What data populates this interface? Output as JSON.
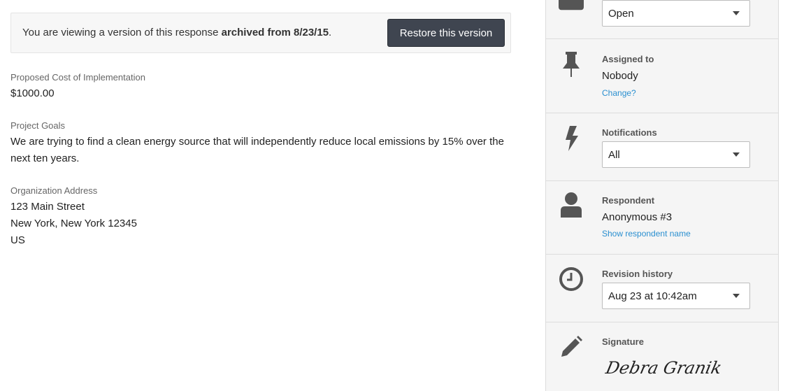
{
  "banner": {
    "text_prefix": "You are viewing a version of this response ",
    "text_bold": "archived from 8/23/15",
    "text_suffix": ".",
    "restore_label": "Restore this version"
  },
  "fields": [
    {
      "label": "Proposed Cost of Implementation",
      "value_lines": [
        "$1000.00"
      ]
    },
    {
      "label": "Project Goals",
      "value_lines": [
        "We are trying to find a clean energy source that will independently reduce local emissions by 15% over the",
        "next ten years."
      ]
    },
    {
      "label": "Organization Address",
      "value_lines": [
        "123 Main Street",
        "New York, New York 12345",
        "US"
      ]
    }
  ],
  "sidebar": {
    "status": {
      "icon": "tag-icon",
      "selected": "Open"
    },
    "assigned": {
      "icon": "pin-icon",
      "title": "Assigned to",
      "value": "Nobody",
      "link": "Change?"
    },
    "notifications": {
      "icon": "lightning-icon",
      "title": "Notifications",
      "selected": "All"
    },
    "respondent": {
      "icon": "person-icon",
      "title": "Respondent",
      "value": "Anonymous #3",
      "link": "Show respondent name"
    },
    "revision": {
      "icon": "clock-icon",
      "title": "Revision history",
      "selected": "Aug 23 at 10:42am"
    },
    "signature": {
      "icon": "pencil-icon",
      "title": "Signature",
      "signed_name": "Debra Granik"
    }
  }
}
